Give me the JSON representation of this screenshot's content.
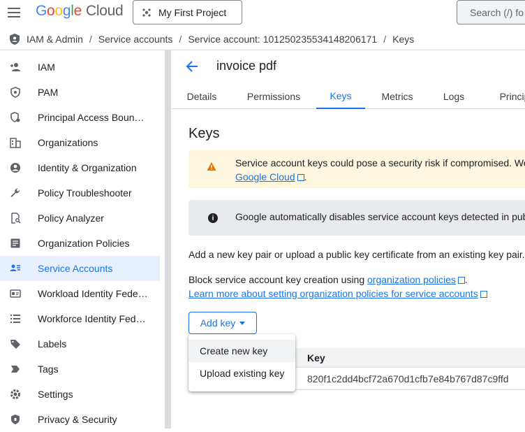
{
  "header": {
    "logo_letters": [
      "G",
      "o",
      "o",
      "g",
      "l",
      "e"
    ],
    "logo_suffix": "Cloud",
    "project": "My First Project",
    "search_placeholder": "Search (/) fo"
  },
  "breadcrumb": [
    "IAM & Admin",
    "Service accounts",
    "Service account: 101250235534148206171",
    "Keys"
  ],
  "sidebar": {
    "items": [
      {
        "label": "IAM",
        "icon": "person-add-icon"
      },
      {
        "label": "PAM",
        "icon": "shield-icon"
      },
      {
        "label": "Principal Access Boun…",
        "icon": "settings-shield-icon"
      },
      {
        "label": "Organizations",
        "icon": "building-icon"
      },
      {
        "label": "Identity & Organization",
        "icon": "account-circle-icon"
      },
      {
        "label": "Policy Troubleshooter",
        "icon": "wrench-icon"
      },
      {
        "label": "Policy Analyzer",
        "icon": "document-search-icon"
      },
      {
        "label": "Organization Policies",
        "icon": "article-icon"
      },
      {
        "label": "Service Accounts",
        "icon": "service-account-icon",
        "active": true
      },
      {
        "label": "Workload Identity Fede…",
        "icon": "id-card-icon"
      },
      {
        "label": "Workforce Identity Fed…",
        "icon": "list-icon"
      },
      {
        "label": "Labels",
        "icon": "label-icon"
      },
      {
        "label": "Tags",
        "icon": "tag-icon"
      },
      {
        "label": "Settings",
        "icon": "gear-icon"
      },
      {
        "label": "Privacy & Security",
        "icon": "privacy-shield-icon"
      }
    ]
  },
  "main": {
    "title": "invoice pdf",
    "tabs": [
      "Details",
      "Permissions",
      "Keys",
      "Metrics",
      "Logs",
      "Princip"
    ],
    "active_tab": "Keys",
    "heading": "Keys",
    "warning": {
      "line1": "Service account keys could pose a security risk if compromised. We",
      "line2_link": "Google Cloud",
      "line2_tail": "."
    },
    "info": "Google automatically disables service account keys detected in pub",
    "para1": "Add a new key pair or upload a public key certificate from an existing key pair.",
    "para2_prefix": "Block service account key creation using ",
    "para2_link": "organization policies",
    "para2_suffix": ".",
    "para3_link": "Learn more about setting organization policies for service accounts",
    "add_key_label": "Add key",
    "table": {
      "header": "Key",
      "rows": [
        "820f1c2dd4bcf72a670d1cfb7e84b767d87c9ffd"
      ]
    },
    "dropdown": [
      "Create new key",
      "Upload existing key"
    ]
  },
  "colors": {
    "accent": "#1a73e8",
    "active_bg": "#e8f0fe",
    "warning_bg": "#fef7e0",
    "warning_icon": "#e37400",
    "info_bg": "#e8eaed"
  }
}
